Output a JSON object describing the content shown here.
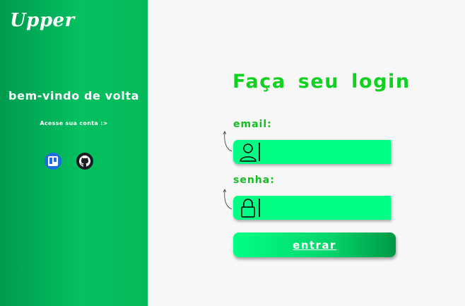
{
  "sidebar": {
    "logo": "Upper",
    "welcome": "bem-vindo de volta",
    "subtitle": "Acesse sua conta :>",
    "social": [
      {
        "icon": "trello-icon",
        "color": "#1c6ee0"
      },
      {
        "icon": "github-icon",
        "color": "#1b1f23"
      }
    ]
  },
  "login": {
    "title": "Faça seu login",
    "email_label": "email:",
    "email_value": "",
    "password_label": "senha:",
    "password_value": "",
    "submit_label": "entrar"
  },
  "colors": {
    "accent": "#10d020",
    "field": "#00ff84",
    "sidebar": "#04c060"
  }
}
